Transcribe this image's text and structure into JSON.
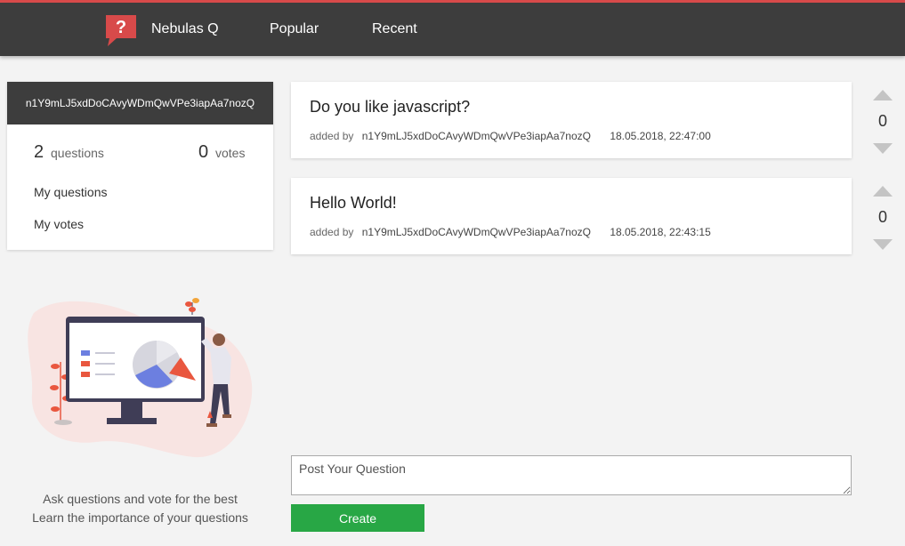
{
  "nav": {
    "brand": "Nebulas Q",
    "popular": "Popular",
    "recent": "Recent",
    "logo_icon": "question-mark-icon",
    "accent": "#d84a4a"
  },
  "profile": {
    "address": "n1Y9mLJ5xdDoCAvyWDmQwVPe3iapAa7nozQ",
    "questions_count": "2",
    "questions_label": "questions",
    "votes_count": "0",
    "votes_label": "votes",
    "my_questions": "My questions",
    "my_votes": "My votes"
  },
  "questions": [
    {
      "title": "Do you like javascript?",
      "added_by": "added by",
      "author": "n1Y9mLJ5xdDoCAvyWDmQwVPe3iapAa7nozQ",
      "date": "18.05.2018, 22:47:00",
      "votes": "0"
    },
    {
      "title": "Hello World!",
      "added_by": "added by",
      "author": "n1Y9mLJ5xdDoCAvyWDmQwVPe3iapAa7nozQ",
      "date": "18.05.2018, 22:43:15",
      "votes": "0"
    }
  ],
  "tagline": {
    "line1": "Ask questions and vote for the best",
    "line2": "Learn the importance of your questions"
  },
  "post": {
    "placeholder": "Post Your Question",
    "button": "Create",
    "button_color": "#28a745"
  }
}
